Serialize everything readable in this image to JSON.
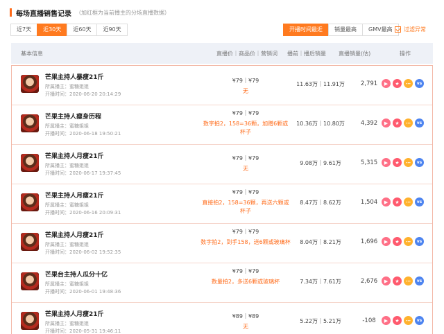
{
  "header": {
    "title": "每场直播销售记录",
    "subtitle": "（加红框为当前播主的分场直播数据）"
  },
  "range_tabs": [
    "近7天",
    "近30天",
    "近60天",
    "近90天"
  ],
  "range_active": 1,
  "sort_tabs": [
    "开播时间最近",
    "销量最高",
    "GMV最高"
  ],
  "sort_active": 0,
  "filter": {
    "label": "过滤异常",
    "checked": true
  },
  "columns": {
    "basic": "基本信息",
    "price": "直播价｜商品价｜营销词",
    "views": "播前｜播后销量",
    "sales": "直播销量(估)",
    "ops": "操作"
  },
  "rows": [
    {
      "name": "芒果主持人暴瘦21斤",
      "anchor": "所属播主：蜜糖姐姐",
      "time": "开播时间：2020-06-20 20:14:29",
      "price": "¥79｜¥79",
      "promo": "无",
      "views": "11.63万｜11.91万",
      "sales": "2,791"
    },
    {
      "name": "芒果主持人瘦身历程",
      "anchor": "所属播主：蜜糖姐姐",
      "time": "开播时间：2020-06-18 19:50:21",
      "price": "¥79｜¥79",
      "promo": "数字拍2，158=36颗，加赠6颗或杯子",
      "views": "10.36万｜10.80万",
      "sales": "4,392"
    },
    {
      "name": "芒果主持人月瘦21斤",
      "anchor": "所属播主：蜜糖姐姐",
      "time": "开播时间：2020-06-17 19:37:45",
      "price": "¥79｜¥79",
      "promo": "无",
      "views": "9.08万｜9.61万",
      "sales": "5,315"
    },
    {
      "name": "芒果主持人月瘦21斤",
      "anchor": "所属播主：蜜糖姐姐",
      "time": "开播时间：2020-06-16 20:09:31",
      "price": "¥79｜¥79",
      "promo": "直接拍2，158=36颗，再送六颗或杯子",
      "views": "8.47万｜8.62万",
      "sales": "1,504"
    },
    {
      "name": "芒果主持人月瘦21斤",
      "anchor": "所属播主：蜜糖姐姐",
      "time": "开播时间：2020-06-02 19:52:35",
      "price": "¥79｜¥79",
      "promo": "数字拍2，到手158，送6颗或玻璃杯",
      "views": "8.04万｜8.21万",
      "sales": "1,696"
    },
    {
      "name": "芒果台主持人瓜分十亿",
      "anchor": "所属播主：蜜糖姐姐",
      "time": "开播时间：2020-06-01 19:48:36",
      "price": "¥79｜¥79",
      "promo": "数量拍2，多送6颗或玻璃杯",
      "views": "7.34万｜7.61万",
      "sales": "2,676"
    },
    {
      "name": "芒果主持人月瘦21斤",
      "anchor": "所属播主：蜜糖姐姐",
      "time": "开播时间：2020-05-31 19:46:11",
      "price": "¥89｜¥89",
      "promo": "无",
      "views": "5.22万｜5.21万",
      "sales": "-108"
    }
  ],
  "icons": [
    "play-icon",
    "star-icon",
    "more-icon",
    "vs-icon"
  ],
  "colors": {
    "accent": "#ff7a1f",
    "row_border": "#f3b9a8",
    "header_bg": "#eef1f7"
  }
}
